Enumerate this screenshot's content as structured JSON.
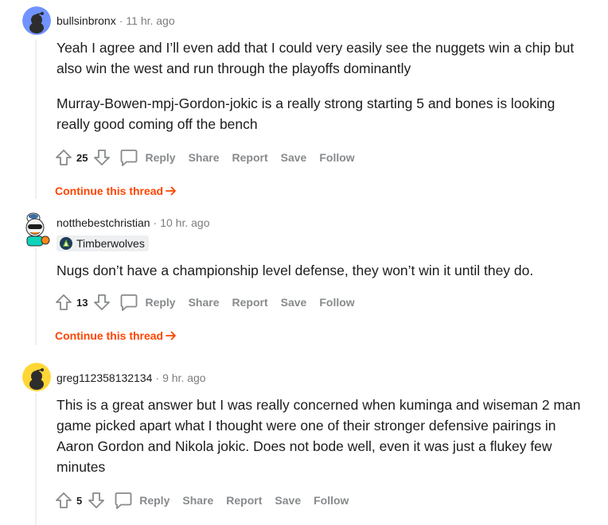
{
  "comments": [
    {
      "username": "bullsinbronx",
      "time": "11 hr. ago",
      "paragraphs": [
        "Yeah I agree and I’ll even add that I could very easily see the nuggets win a chip but also win the west and run through the playoffs dominantly",
        "Murray-Bowen-mpj-Gordon-jokic is a really strong starting 5 and bones is looking really good coming off the bench"
      ],
      "score": "25",
      "continue_label": "Continue this thread"
    },
    {
      "username": "notthebestchristian",
      "time": "10 hr. ago",
      "flair": "Timberwolves",
      "paragraphs": [
        "Nugs don’t have a championship level defense, they won’t win it until they do."
      ],
      "score": "13",
      "continue_label": "Continue this thread"
    },
    {
      "username": "greg112358132134",
      "time": "9 hr. ago",
      "paragraphs": [
        "This is a great answer but I was really concerned when kuminga and wiseman 2 man game picked apart what I thought were one of their stronger defensive pairings in Aaron Gordon and Nikola jokic. Does not bode well, even it was just a flukey few minutes"
      ],
      "score": "5"
    }
  ],
  "actions": {
    "reply": "Reply",
    "share": "Share",
    "report": "Report",
    "save": "Save",
    "follow": "Follow"
  },
  "separator": "·",
  "icons": {
    "upvote": "upvote-arrow-icon",
    "downvote": "downvote-arrow-icon",
    "reply": "speech-bubble-icon",
    "continue": "right-arrow-icon"
  },
  "colors": {
    "accent": "#ff4500",
    "muted": "#878a8c",
    "avatar1": "#7193ff",
    "avatar3": "#ffd635"
  }
}
